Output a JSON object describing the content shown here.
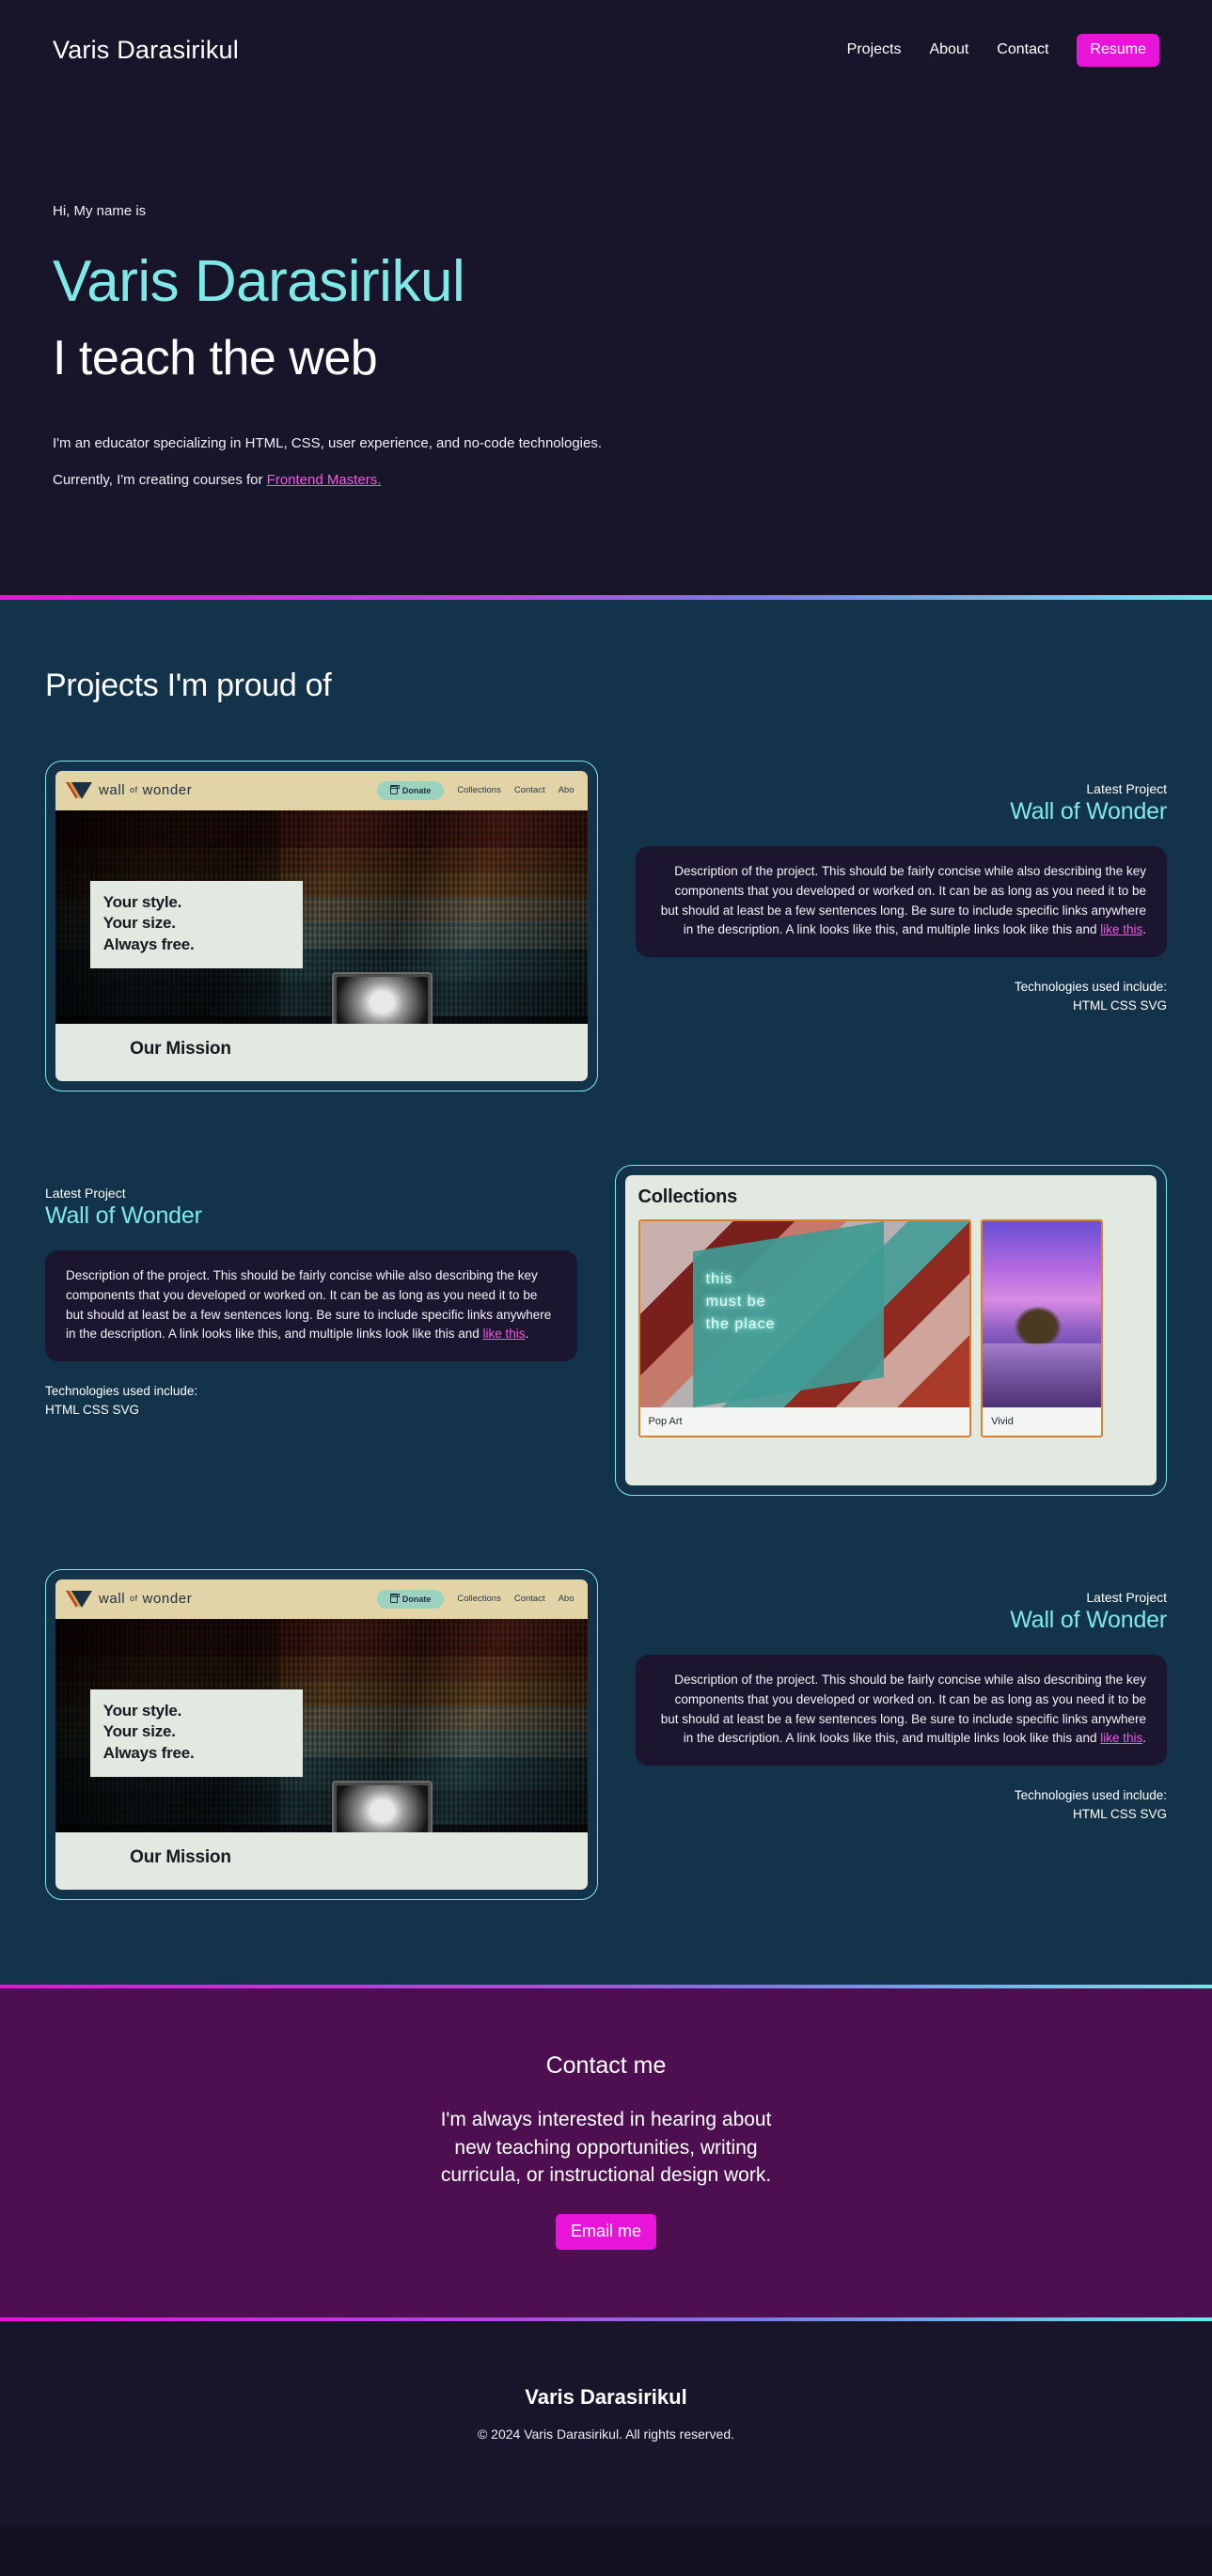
{
  "header": {
    "brand": "Varis Darasirikul",
    "nav": [
      {
        "label": "Projects"
      },
      {
        "label": "About"
      },
      {
        "label": "Contact"
      }
    ],
    "resume_label": "Resume"
  },
  "hero": {
    "greeting": "Hi, My name is",
    "name": "Varis Darasirikul",
    "tagline": "I teach the web",
    "bio": "I'm an educator specializing in HTML, CSS, user experience, and no-code technologies.",
    "current_prefix": "Currently, I'm creating courses for ",
    "current_link": "Frontend Masters."
  },
  "projects": {
    "heading": "Projects I'm proud of",
    "items": [
      {
        "eyebrow": "Latest Project",
        "title": "Wall of Wonder",
        "description_part1": "Description of the project. This should be fairly concise while also describing the key components that you developed or worked on. It can be as long as you need it to be but should at least be a few sentences long. Be sure to include specific links anywhere in the description. A link looks like this, and multiple links look like this and ",
        "description_link": "like this",
        "description_part2": ".",
        "tech_label": "Technologies used include:",
        "tech_list": "HTML CSS SVG",
        "align": "right",
        "mock": "wall-of-wonder"
      },
      {
        "eyebrow": "Latest Project",
        "title": "Wall of Wonder",
        "description_part1": "Description of the project. This should be fairly concise while also describing the key components that you developed or worked on. It can be as long as you need it to be but should at least be a few sentences long. Be sure to include specific links anywhere in the description. A link looks like this, and multiple links look like this and ",
        "description_link": "like this",
        "description_part2": ".",
        "tech_label": "Technologies used include:",
        "tech_list": "HTML CSS SVG",
        "align": "left",
        "mock": "collections"
      },
      {
        "eyebrow": "Latest Project",
        "title": "Wall of Wonder",
        "description_part1": "Description of the project. This should be fairly concise while also describing the key components that you developed or worked on. It can be as long as you need it to be but should at least be a few sentences long. Be sure to include specific links anywhere in the description. A link looks like this, and multiple links look like this and ",
        "description_link": "like this",
        "description_part2": ".",
        "tech_label": "Technologies used include:",
        "tech_list": "HTML CSS SVG",
        "align": "right",
        "mock": "wall-of-wonder"
      }
    ]
  },
  "mock_wow": {
    "brand": "wall",
    "brand_of": "of",
    "brand2": "wonder",
    "donate": "Donate",
    "nav": [
      {
        "label": "Collections"
      },
      {
        "label": "Contact"
      },
      {
        "label": "Abo"
      }
    ],
    "headline_1": "Your style.",
    "headline_2": "Your size.",
    "headline_3": "Always free.",
    "mission": "Our Mission"
  },
  "mock_collections": {
    "heading": "Collections",
    "cards": [
      {
        "label": "Pop Art",
        "neon_1": "this",
        "neon_2": "must be",
        "neon_3": "the place"
      },
      {
        "label": "Vivid"
      }
    ]
  },
  "contact": {
    "heading": "Contact me",
    "body": "I'm always interested in hearing about new teaching opportunities, writing curricula, or instructional design work.",
    "button": "Email me"
  },
  "footer": {
    "name": "Varis Darasirikul",
    "copyright": "© 2024 Varis Darasirikul. All rights reserved."
  },
  "colors": {
    "accent_pink": "#e814d8",
    "accent_cyan": "#7fe9e8",
    "hero_bg": "#18142a",
    "projects_bg": "#123349",
    "contact_bg": "#4d0f50"
  }
}
